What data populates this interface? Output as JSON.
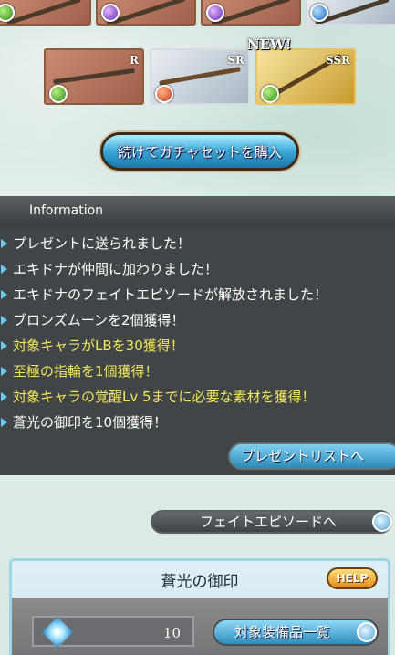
{
  "rewards": {
    "top_row": [
      {
        "element": "green"
      },
      {
        "element": "purple"
      },
      {
        "element": "purple"
      },
      {
        "element": "blue"
      }
    ],
    "row2": [
      {
        "rarity": "R",
        "element": "green"
      },
      {
        "rarity": "SR",
        "element": "red"
      },
      {
        "rarity": "SSR",
        "element": "green",
        "new": "NEW!"
      }
    ]
  },
  "gacha_button_label": "続けてガチャセットを購入",
  "information": {
    "header": "Information",
    "items": [
      {
        "text": "プレゼントに送られました！",
        "highlight": false
      },
      {
        "text": "エキドナが仲間に加わりました！",
        "highlight": false
      },
      {
        "text": "エキドナのフェイトエピソードが解放されました！",
        "highlight": false
      },
      {
        "text": "ブロンズムーンを2個獲得！",
        "highlight": false
      },
      {
        "text": "対象キャラがLBを30獲得！",
        "highlight": true
      },
      {
        "text": "至極の指輪を1個獲得！",
        "highlight": true
      },
      {
        "text": "対象キャラの覚醒Lv 5までに必要な素材を獲得！",
        "highlight": true
      },
      {
        "text": "蒼光の御印を10個獲得！",
        "highlight": false
      }
    ],
    "present_list_button": "プレゼントリストへ"
  },
  "fate_episode_button": "フェイトエピソードへ",
  "seal_panel": {
    "title": "蒼光の御印",
    "help_button": "HELP",
    "count": "10",
    "equipment_list_button": "対象装備品一覧"
  },
  "colors": {
    "highlight_text": "#f4e85a",
    "info_background": "#34383a",
    "button_blue": "#3ba8d8"
  }
}
